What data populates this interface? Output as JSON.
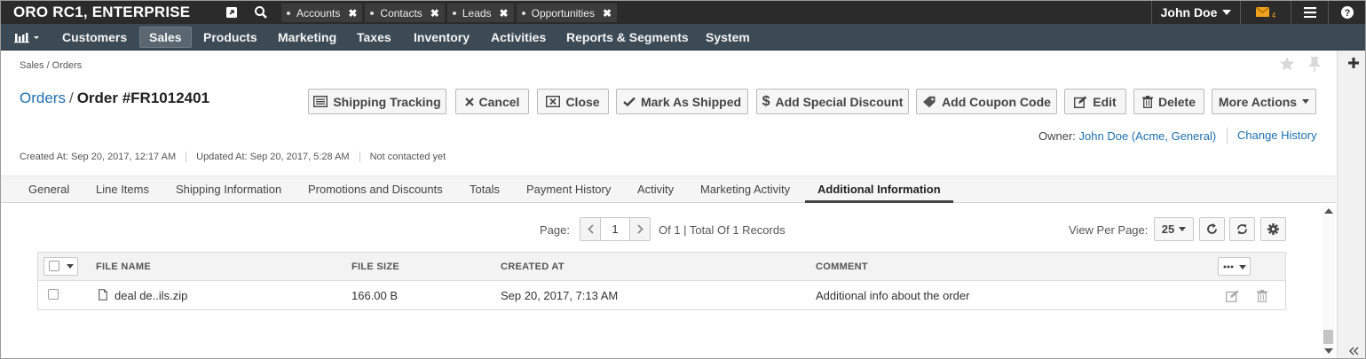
{
  "app": {
    "brand": "ORO RC1, ENTERPRISE"
  },
  "pinned_tabs": [
    {
      "label": "Accounts"
    },
    {
      "label": "Contacts"
    },
    {
      "label": "Leads"
    },
    {
      "label": "Opportunities"
    }
  ],
  "user": {
    "name": "John Doe",
    "notifications": "4"
  },
  "nav": {
    "items": [
      "Customers",
      "Sales",
      "Products",
      "Marketing",
      "Taxes",
      "Inventory",
      "Activities",
      "Reports & Segments",
      "System"
    ],
    "active": "Sales"
  },
  "breadcrumb": "Sales / Orders",
  "page": {
    "parent_link": "Orders",
    "separator": "/",
    "title": "Order #FR1012401"
  },
  "actions": {
    "shipping_tracking": "Shipping Tracking",
    "cancel": "Cancel",
    "close": "Close",
    "mark_as_shipped": "Mark As Shipped",
    "add_special_discount": "Add Special Discount",
    "add_coupon_code": "Add Coupon Code",
    "edit": "Edit",
    "delete": "Delete",
    "more_actions": "More Actions"
  },
  "owner": {
    "label": "Owner:",
    "name": "John Doe",
    "org": "(Acme, General)",
    "change_history": "Change History"
  },
  "meta": {
    "created": "Created At: Sep 20, 2017, 12:17 AM",
    "updated": "Updated At: Sep 20, 2017, 5:28 AM",
    "contacted": "Not contacted yet"
  },
  "tabs": [
    "General",
    "Line Items",
    "Shipping Information",
    "Promotions and Discounts",
    "Totals",
    "Payment History",
    "Activity",
    "Marketing Activity",
    "Additional Information"
  ],
  "active_tab": "Additional Information",
  "pager": {
    "label": "Page:",
    "current": "1",
    "of": "Of 1 | Total Of 1 Records",
    "view_per_page_label": "View Per Page:",
    "per_page": "25"
  },
  "grid": {
    "columns": [
      "FILE NAME",
      "FILE SIZE",
      "CREATED AT",
      "COMMENT"
    ],
    "rows": [
      {
        "file_name": "deal de..ils.zip",
        "file_size": "166.00 B",
        "created_at": "Sep 20, 2017, 7:13 AM",
        "comment": "Additional info about the order"
      }
    ]
  },
  "colors": {
    "topbar": "#2b2b2b",
    "navbar": "#3c4a55",
    "link": "#1f6fb0",
    "notification": "#f0a01a"
  }
}
